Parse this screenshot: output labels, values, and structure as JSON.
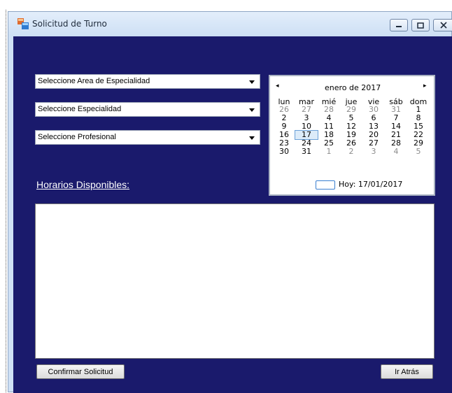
{
  "window": {
    "title": "Solicitud de Turno"
  },
  "form": {
    "area_select": "Seleccione Area de Especialidad",
    "specialty_select": "Seleccione Especialidad",
    "professional_select": "Seleccione Profesional",
    "horarios_label": "Horarios Disponibles:"
  },
  "calendar": {
    "prev": "◂",
    "next": "▸",
    "month_title": "enero de 2017",
    "weekdays": [
      "lun",
      "mar",
      "mié",
      "jue",
      "vie",
      "sáb",
      "dom"
    ],
    "weeks": [
      [
        "26",
        "27",
        "28",
        "29",
        "30",
        "31",
        "1"
      ],
      [
        "2",
        "3",
        "4",
        "5",
        "6",
        "7",
        "8"
      ],
      [
        "9",
        "10",
        "11",
        "12",
        "13",
        "14",
        "15"
      ],
      [
        "16",
        "17",
        "18",
        "19",
        "20",
        "21",
        "22"
      ],
      [
        "23",
        "24",
        "25",
        "26",
        "27",
        "28",
        "29"
      ],
      [
        "30",
        "31",
        "1",
        "2",
        "3",
        "4",
        "5"
      ]
    ],
    "today_label": "Hoy: 17/01/2017"
  },
  "buttons": {
    "confirm": "Confirmar Solicitud",
    "back": "Ir Atrás"
  },
  "colors": {
    "client_background": "#1a1a6c",
    "selected_day_outline": "#6aa0d8"
  }
}
